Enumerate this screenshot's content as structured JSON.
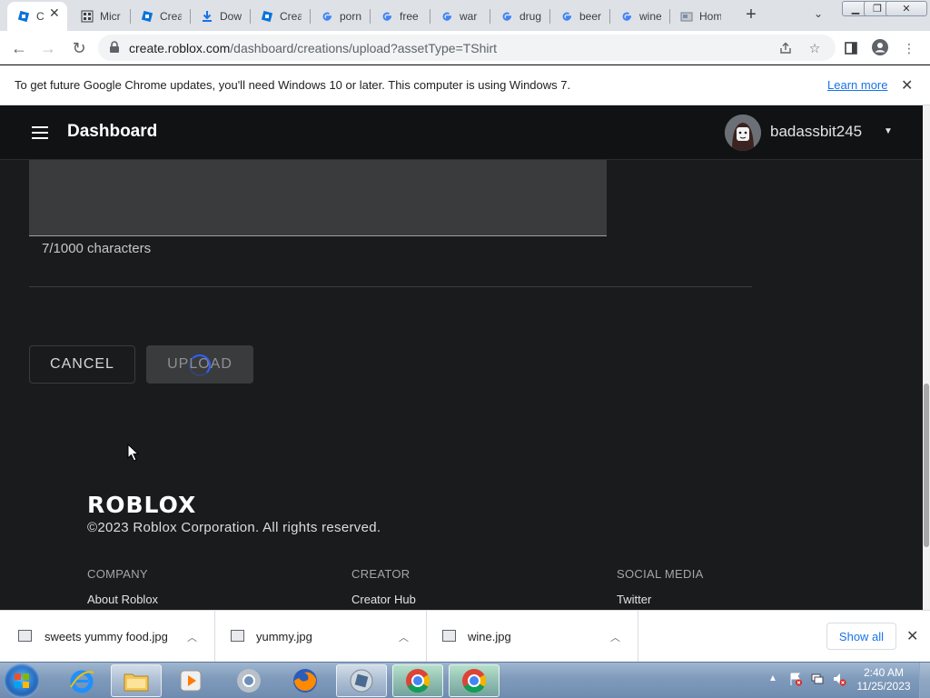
{
  "browser": {
    "tabs": [
      {
        "title": "C",
        "icon": "roblox-studio-icon",
        "active": true
      },
      {
        "title": "Micr",
        "icon": "microsoft-icon"
      },
      {
        "title": "Crea",
        "icon": "roblox-studio-icon"
      },
      {
        "title": "Dow",
        "icon": "download-icon"
      },
      {
        "title": "Crea",
        "icon": "roblox-studio-icon"
      },
      {
        "title": "porn",
        "icon": "google-icon"
      },
      {
        "title": "free",
        "icon": "google-icon"
      },
      {
        "title": "war",
        "icon": "google-icon"
      },
      {
        "title": "drug",
        "icon": "google-icon"
      },
      {
        "title": "beer",
        "icon": "google-icon"
      },
      {
        "title": "wine",
        "icon": "google-icon"
      },
      {
        "title": "Hom",
        "icon": "page-icon"
      }
    ],
    "url_host": "create.roblox.com",
    "url_path": "/dashboard/creations/upload?assetType=TShirt"
  },
  "infobar": {
    "text": "To get future Google Chrome updates, you'll need Windows 10 or later. This computer is using Windows 7.",
    "link": "Learn more"
  },
  "header": {
    "title": "Dashboard",
    "username": "badassbit245"
  },
  "form": {
    "char_count": "7/1000 characters",
    "cancel_label": "CANCEL",
    "upload_label": "UPLOAD"
  },
  "footer": {
    "logo": "ROBLOX",
    "copyright": "©2023 Roblox Corporation. All rights reserved.",
    "columns": [
      {
        "heading": "COMPANY",
        "link": "About Roblox"
      },
      {
        "heading": "CREATOR",
        "link": "Creator Hub"
      },
      {
        "heading": "SOCIAL MEDIA",
        "link": "Twitter"
      }
    ]
  },
  "downloads": {
    "items": [
      "sweets yummy food.jpg",
      "yummy.jpg",
      "wine.jpg"
    ],
    "show_all": "Show all"
  },
  "taskbar": {
    "time": "2:40 AM",
    "date": "11/25/2023"
  },
  "colors": {
    "page_bg": "#191b1d",
    "header_bg": "#111214",
    "spinner": "#335fff",
    "link_blue": "#1a73e8"
  }
}
